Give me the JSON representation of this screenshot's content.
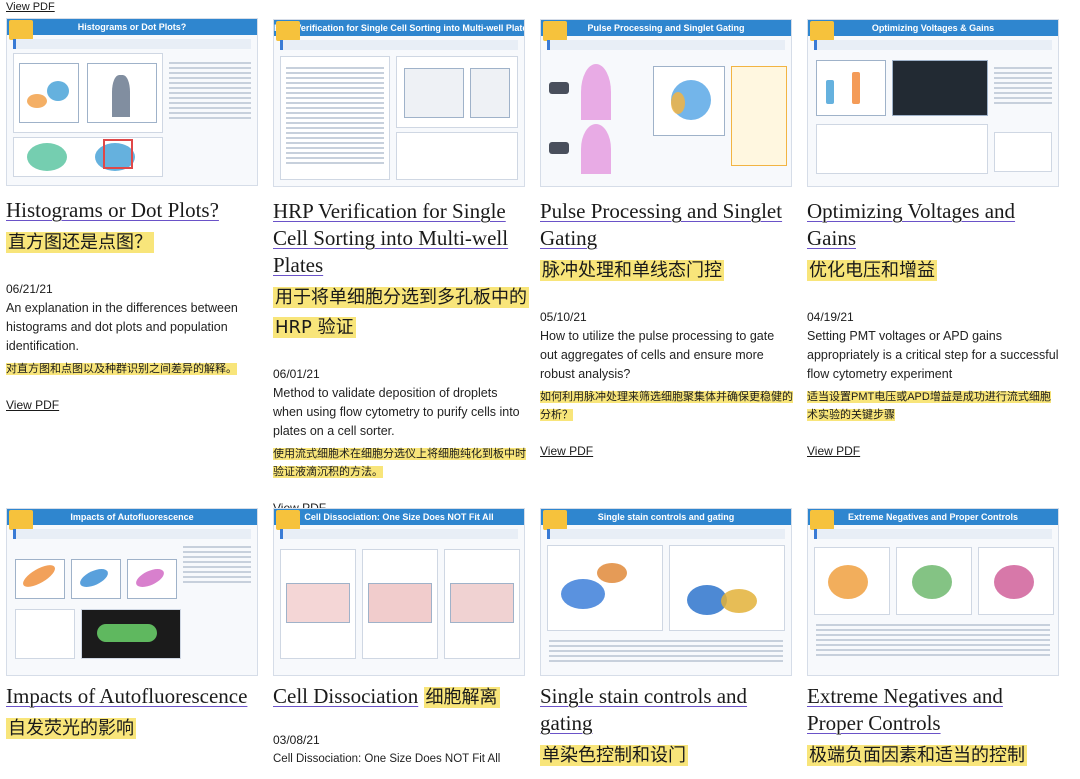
{
  "top_link": "View PDF",
  "cards": [
    {
      "thumb_title": "Histograms or Dot Plots?",
      "title": "Histograms or Dot Plots?",
      "title_zh": "直方图还是点图？",
      "date": "06/21/21",
      "desc": "An explanation in the differences between histograms and dot plots and population identification.",
      "desc_zh": "对直方图和点图以及种群识别之间差异的解释。",
      "view": "View PDF"
    },
    {
      "thumb_title": "HRP Verification for Single Cell Sorting into Multi-well Plates",
      "title": "HRP Verification for Single Cell Sorting into Multi-well Plates",
      "title_zh": "用于将单细胞分选到多孔板中的 HRP 验证",
      "date": "06/01/21",
      "desc": "Method to validate deposition of droplets when using flow cytometry to purify cells into plates on a cell sorter.",
      "desc_zh": "使用流式细胞术在细胞分选仪上将细胞纯化到板中时验证液滴沉积的方法。",
      "view": "View PDF"
    },
    {
      "thumb_title": "Pulse Processing and Singlet Gating",
      "title": "Pulse Processing and Singlet Gating",
      "title_zh": "脉冲处理和单线态门控",
      "date": "05/10/21",
      "desc": "How to utilize the pulse processing to gate out aggregates of cells and ensure more robust analysis?",
      "desc_zh": "如何利用脉冲处理来筛选细胞聚集体并确保更稳健的分析？",
      "view": "View PDF"
    },
    {
      "thumb_title": "Optimizing Voltages & Gains",
      "title": "Optimizing Voltages and Gains",
      "title_zh": "优化电压和增益",
      "date": "04/19/21",
      "desc": "Setting PMT voltages or APD gains appropriately is a critical step for a successful flow cytometry experiment",
      "desc_zh": "适当设置PMT电压或APD增益是成功进行流式细胞术实验的关键步骤",
      "view": "View PDF"
    },
    {
      "thumb_title": "Impacts of Autofluorescence",
      "title": "Impacts of Autofluorescence",
      "title_zh": "自发荧光的影响"
    },
    {
      "thumb_title": "Cell Dissociation: One Size Does NOT Fit All",
      "title": "Cell Dissociation",
      "title_zh": "细胞解离",
      "date": "03/08/21",
      "desc": "Cell Dissociation: One Size Does NOT Fit All"
    },
    {
      "thumb_title": "Single stain controls and gating",
      "title": "Single stain controls and gating",
      "title_zh": "单染色控制和设门"
    },
    {
      "thumb_title": "Extreme Negatives and Proper Controls",
      "title": "Extreme Negatives and Proper Controls",
      "title_zh": "极端负面因素和适当的控制"
    }
  ],
  "colors": {
    "accent": "#2f86cf",
    "highlight": "#f8e57a",
    "underline": "#6a52c8"
  }
}
